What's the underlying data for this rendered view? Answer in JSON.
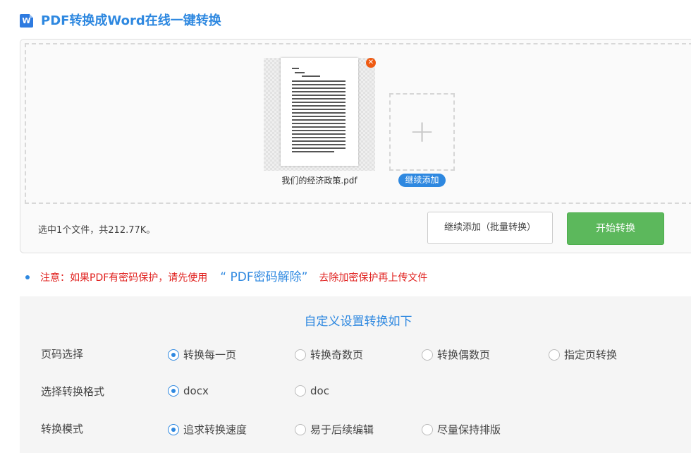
{
  "header": {
    "icon_letter": "W",
    "title": "PDF转换成Word在线一键转换"
  },
  "upload": {
    "file_name": "我们的经济政策.pdf",
    "remove_icon": "close-icon",
    "add_badge": "继续添加",
    "selected_info": "选中1个文件，共212.77K。",
    "continue_button": "继续添加（批量转换）",
    "start_button": "开始转换"
  },
  "notice": {
    "prefix": "注意：如果PDF有密码保护，请先使用",
    "link": "“ PDF密码解除”",
    "suffix": "去除加密保护再上传文件"
  },
  "settings": {
    "title": "自定义设置转换如下",
    "rows": [
      {
        "label": "页码选择",
        "options": [
          "转换每一页",
          "转换奇数页",
          "转换偶数页",
          "指定页转换"
        ],
        "selected": 0
      },
      {
        "label": "选择转换格式",
        "options": [
          "docx",
          "doc"
        ],
        "selected": 0
      },
      {
        "label": "转换模式",
        "options": [
          "追求转换速度",
          "易于后续编辑",
          "尽量保持排版"
        ],
        "selected": 0
      }
    ]
  },
  "colors": {
    "accent": "#2e88e0",
    "start_green": "#5cb85c",
    "notice_red": "#e0201e",
    "remove_orange": "#ef5a12"
  }
}
